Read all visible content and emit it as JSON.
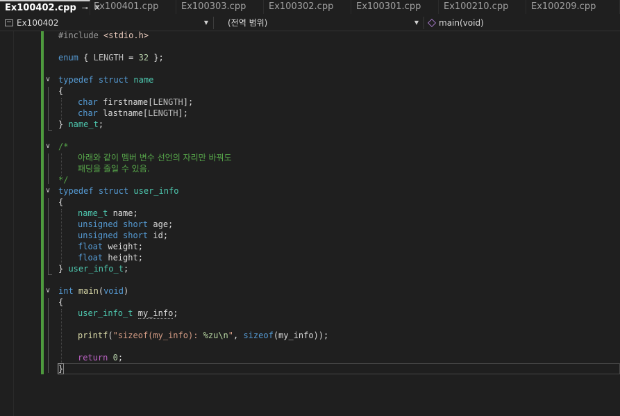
{
  "tabs": [
    {
      "label": "Ex100402.cpp",
      "active": true
    },
    {
      "label": "Ex100401.cpp"
    },
    {
      "label": "Ex100303.cpp"
    },
    {
      "label": "Ex100302.cpp"
    },
    {
      "label": "Ex100301.cpp"
    },
    {
      "label": "Ex100210.cpp"
    },
    {
      "label": "Ex100209.cpp"
    }
  ],
  "tab_pin_glyph": "⊸",
  "tab_close_glyph": "✕",
  "navbar": {
    "project": "Ex100402",
    "scope": "(전역 범위)",
    "member": "main(void)"
  },
  "icons": {
    "project": "file-icon",
    "member": "cube-icon",
    "dropdown": "chevron-down-icon",
    "fold": "chevron-down-icon"
  },
  "colors": {
    "change_bar": "#4e9a3e",
    "keyword": "#569cd6",
    "type": "#4ec9b0",
    "comment": "#57a64a",
    "function": "#dcdcaa",
    "string": "#d69d85",
    "number": "#b5cea8"
  },
  "code": {
    "l1": {
      "a": "#include ",
      "b": "<stdio.h>"
    },
    "l3": {
      "a": "enum",
      "b": " { ",
      "c": "LENGTH",
      "d": " = ",
      "e": "32",
      "f": " };"
    },
    "l5": {
      "a": "typedef",
      "b": " ",
      "c": "struct",
      "d": " ",
      "e": "name"
    },
    "l6": "{",
    "l7": {
      "a": "char",
      "b": " firstname[",
      "c": "LENGTH",
      "d": "];"
    },
    "l8": {
      "a": "char",
      "b": " lastname[",
      "c": "LENGTH",
      "d": "];"
    },
    "l9": {
      "a": "} ",
      "b": "name_t",
      "c": ";"
    },
    "l11": "/*",
    "l12": "아래와 같이 멤버 변수 선언의 자리만 바꿔도",
    "l13": "패딩을 줄일 수 있음.",
    "l14": "*/",
    "l15": {
      "a": "typedef",
      "b": " ",
      "c": "struct",
      "d": " ",
      "e": "user_info"
    },
    "l16": "{",
    "l17": {
      "a": "name_t",
      "b": " name;"
    },
    "l18": {
      "a": "unsigned",
      "b": " ",
      "c": "short",
      "d": " age;"
    },
    "l19": {
      "a": "unsigned",
      "b": " ",
      "c": "short",
      "d": " id;"
    },
    "l20": {
      "a": "float",
      "b": " weight;"
    },
    "l21": {
      "a": "float",
      "b": " height;"
    },
    "l22": {
      "a": "} ",
      "b": "user_info_t",
      "c": ";"
    },
    "l24": {
      "a": "int",
      "b": " ",
      "c": "main",
      "d": "(",
      "e": "void",
      "f": ")"
    },
    "l25": "{",
    "l26": {
      "a": "user_info_t",
      "b": " ",
      "c": "my_info",
      "d": ";"
    },
    "l28": {
      "a": "printf",
      "b": "(",
      "c": "\"sizeof(my_info): ",
      "d": "%zu\\n",
      "e": "\"",
      "f": ", ",
      "g": "sizeof",
      "h": "(my_info));"
    },
    "l30": {
      "a": "return",
      "b": " ",
      "c": "0",
      "d": ";"
    },
    "l31": "}"
  }
}
